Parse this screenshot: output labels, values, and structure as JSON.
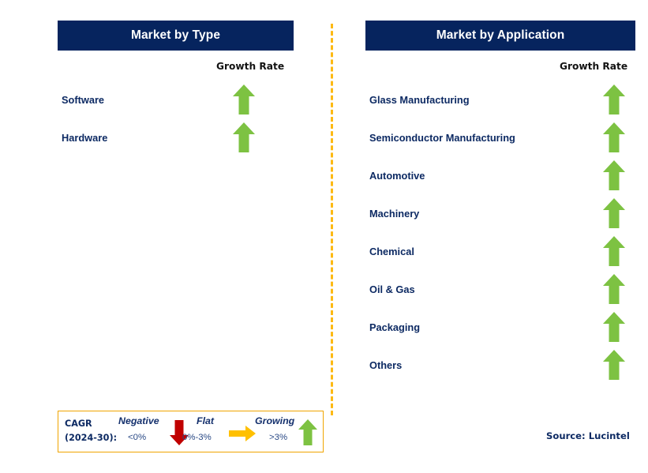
{
  "theme": {
    "header_bg": "#06245e",
    "header_text": "#ffffff",
    "label_text": "#0d2a63",
    "arrow_green": "#7dc242",
    "arrow_red": "#c00000",
    "arrow_orange": "#ffc000",
    "divider_color": "#fdb913",
    "legend_border": "#f0a500",
    "page_bg": "#ffffff"
  },
  "panels": [
    {
      "id": "type",
      "title": "Market by Type",
      "growth_rate_label": "Growth Rate",
      "rows": [
        {
          "label": "Software",
          "growth": "growing",
          "icon": "arrow-up-icon"
        },
        {
          "label": "Hardware",
          "growth": "growing",
          "icon": "arrow-up-icon"
        }
      ]
    },
    {
      "id": "application",
      "title": "Market by Application",
      "growth_rate_label": "Growth Rate",
      "rows": [
        {
          "label": "Glass Manufacturing",
          "growth": "growing",
          "icon": "arrow-up-icon"
        },
        {
          "label": "Semiconductor Manufacturing",
          "growth": "growing",
          "icon": "arrow-up-icon"
        },
        {
          "label": "Automotive",
          "growth": "growing",
          "icon": "arrow-up-icon"
        },
        {
          "label": "Machinery",
          "growth": "growing",
          "icon": "arrow-up-icon"
        },
        {
          "label": "Chemical",
          "growth": "growing",
          "icon": "arrow-up-icon"
        },
        {
          "label": "Oil & Gas",
          "growth": "growing",
          "icon": "arrow-up-icon"
        },
        {
          "label": "Packaging",
          "growth": "growing",
          "icon": "arrow-up-icon"
        },
        {
          "label": "Others",
          "growth": "growing",
          "icon": "arrow-up-icon"
        }
      ]
    }
  ],
  "legend": {
    "cagr_line1": "CAGR",
    "cagr_line2": "(2024-30):",
    "items": [
      {
        "title": "Negative",
        "range": "<0%",
        "icon": "arrow-down-icon",
        "color": "#c00000"
      },
      {
        "title": "Flat",
        "range": "0%-3%",
        "icon": "arrow-right-icon",
        "color": "#ffc000"
      },
      {
        "title": "Growing",
        "range": ">3%",
        "icon": "arrow-up-icon",
        "color": "#7dc242"
      }
    ]
  },
  "source_note": "Source: Lucintel"
}
